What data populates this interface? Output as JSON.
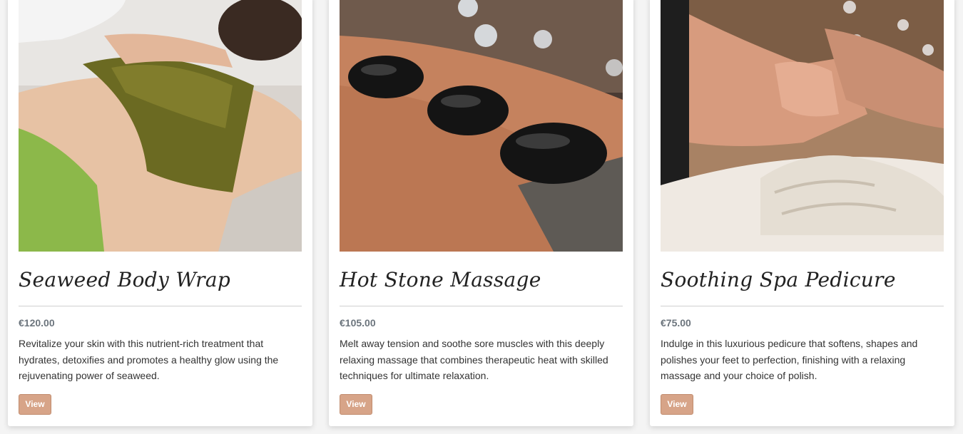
{
  "treatments": [
    {
      "title": "Seaweed Body Wrap",
      "price": "€120.00",
      "description": "Revitalize your skin with this nutrient-rich treatment that hydrates, detoxifies and promotes a healthy glow using the rejuvenating power of seaweed.",
      "button_label": "View",
      "photo_subject": "seaweed-wrap-photo"
    },
    {
      "title": "Hot Stone Massage",
      "price": "€105.00",
      "description": "Melt away tension and soothe sore muscles with this deeply relaxing massage that combines therapeutic heat with skilled techniques for ultimate relaxation.",
      "button_label": "View",
      "photo_subject": "hot-stones-photo"
    },
    {
      "title": "Soothing Spa Pedicure",
      "price": "€75.00",
      "description": "Indulge in this luxurious pedicure that softens, shapes and polishes your feet to perfection, finishing with a relaxing massage and your choice of polish.",
      "button_label": "View",
      "photo_subject": "pedicure-photo"
    }
  ],
  "colors": {
    "button": "#d7a488",
    "price": "#6c757d",
    "title": "#222222"
  }
}
